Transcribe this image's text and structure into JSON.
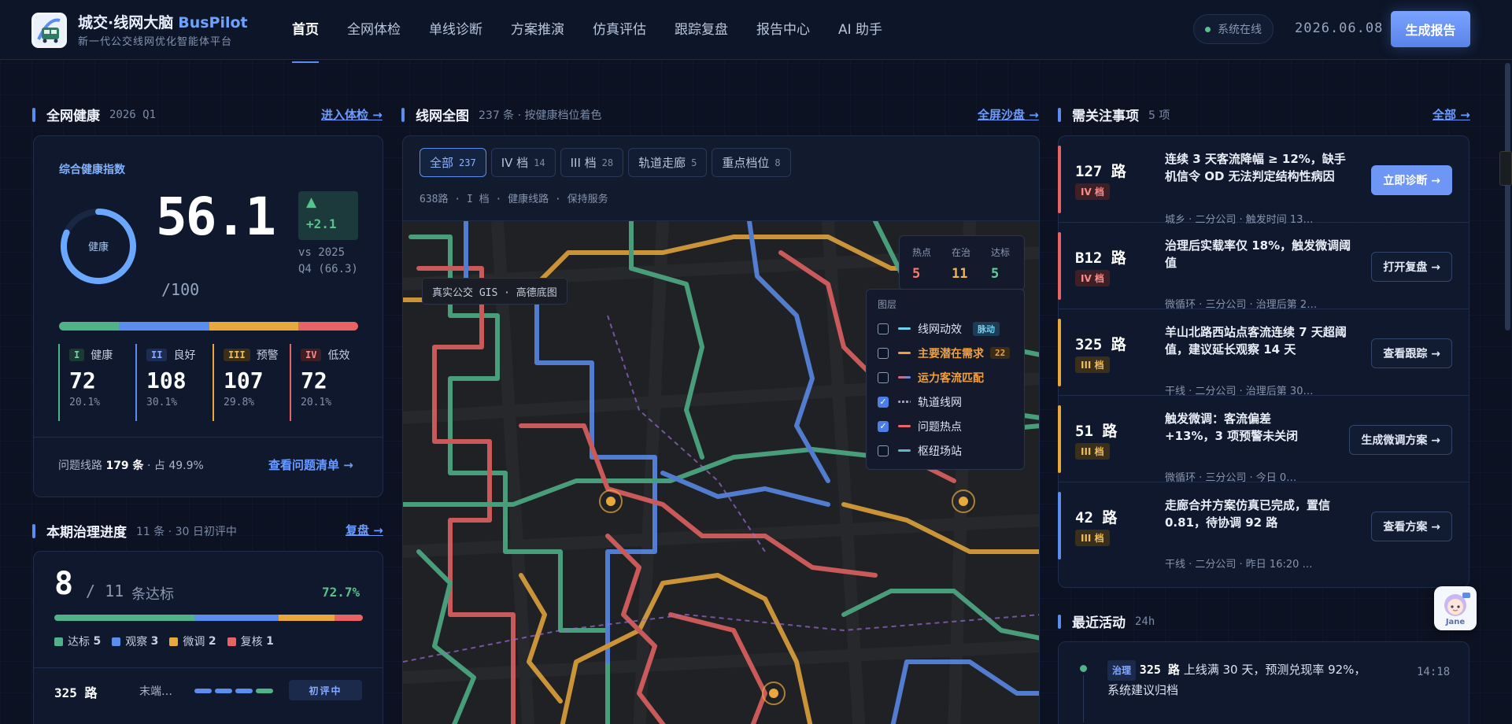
{
  "app": {
    "name_cn": "城交·线网大脑",
    "name_en": "BusPilot",
    "tagline": "新一代公交线网优化智能体平台",
    "status": "系统在线",
    "date": "2026.06.08",
    "generate_report": "生成报告",
    "nav": [
      "首页",
      "全网体检",
      "单线诊断",
      "方案推演",
      "仿真评估",
      "跟踪复盘",
      "报告中心",
      "AI 助手"
    ]
  },
  "health": {
    "title": "全网健康",
    "period": "2026 Q1",
    "link": "进入体检 →",
    "card_label": "综合健康指数",
    "ring_label": "健康",
    "ring_fraction": 0.561,
    "score": "56.1",
    "score_max": "/100",
    "delta_arrow": "▲",
    "delta": "+2.1",
    "compare": "vs 2025 Q4 (66.3)",
    "levels": [
      {
        "code": "I",
        "name": "健康",
        "count": "72",
        "pct": "20.1%",
        "color": "#4fb38a",
        "share": 0.201
      },
      {
        "code": "II",
        "name": "良好",
        "count": "108",
        "pct": "30.1%",
        "color": "#5b8def",
        "share": 0.301
      },
      {
        "code": "III",
        "name": "预警",
        "count": "107",
        "pct": "29.8%",
        "color": "#e8a83c",
        "share": 0.298
      },
      {
        "code": "IV",
        "name": "低效",
        "count": "72",
        "pct": "20.1%",
        "color": "#e86464",
        "share": 0.201
      }
    ],
    "problem_prefix": "问题线路",
    "problem_count": "179 条",
    "problem_share": "· 占 49.9%",
    "problem_link": "查看问题清单 →"
  },
  "progress": {
    "title": "本期治理进度",
    "sub": "11 条 · 30 日初评中",
    "link": "复盘 →",
    "done": "8",
    "total": "/ 11",
    "unit": "条达标",
    "rate": "72.7%",
    "segments": [
      {
        "label": "达标",
        "count": "5",
        "color": "#4fb38a",
        "share": 0.4545
      },
      {
        "label": "观察",
        "count": "3",
        "color": "#5b8def",
        "share": 0.2727
      },
      {
        "label": "微调",
        "count": "2",
        "color": "#e8a83c",
        "share": 0.1818
      },
      {
        "label": "复核",
        "count": "1",
        "color": "#e86464",
        "share": 0.0909
      }
    ],
    "row": {
      "route": "325 路",
      "desc": "末端…",
      "badge": "初评中"
    }
  },
  "map": {
    "title": "线网全图",
    "sub": "237 条 · 按健康档位着色",
    "link": "全屏沙盘 →",
    "tabs": [
      {
        "label": "全部",
        "count": "237"
      },
      {
        "label": "IV 档",
        "count": "14"
      },
      {
        "label": "III 档",
        "count": "28"
      },
      {
        "label": "轨道走廊",
        "count": "5"
      },
      {
        "label": "重点档位",
        "count": "8"
      }
    ],
    "hint": "638路 · I 档 · 健康线路 · 保持服务",
    "overlay_label": "真实公交 GIS · 高德底图",
    "stats": [
      {
        "label": "热点",
        "value": "5",
        "color": "#ff7a6a"
      },
      {
        "label": "在治",
        "value": "11",
        "color": "#f0b44a"
      },
      {
        "label": "达标",
        "value": "5",
        "color": "#5fcf98"
      }
    ],
    "layers_title": "图层",
    "layers": [
      {
        "label": "线网动效",
        "checked": false,
        "color": "#6fd0f0",
        "badge": "脉动"
      },
      {
        "label": "主要潜在需求",
        "checked": false,
        "color": "#f0a040",
        "badge": "22"
      },
      {
        "label": "运力客流匹配",
        "checked": false,
        "color": "#e86464",
        "badge": ""
      },
      {
        "label": "轨道线网",
        "checked": true,
        "color": "#8fa0c0",
        "badge": ""
      },
      {
        "label": "问题热点",
        "checked": true,
        "color": "#e86464",
        "badge": ""
      },
      {
        "label": "枢纽场站",
        "checked": false,
        "color": "#5fb8c8",
        "badge": ""
      }
    ]
  },
  "alerts": {
    "title": "需关注事项",
    "count": "5 项",
    "link": "全部 →",
    "items": [
      {
        "route": "127 路",
        "level": "IV 档",
        "color": "#e86464",
        "text": "连续 3 天客流降幅 ≥ 12%，缺手机信令 OD 无法判定结构性病因",
        "meta": "城乡 · 二分公司 · 触发时间 13…",
        "action": "立即诊断 →",
        "primary": true
      },
      {
        "route": "B12 路",
        "level": "IV 档",
        "color": "#e86464",
        "text": "治理后实载率仅 18%，触发微调阈值",
        "meta": "微循环 · 三分公司 · 治理后第 2…",
        "action": "打开复盘 →",
        "primary": false
      },
      {
        "route": "325 路",
        "level": "III 档",
        "color": "#e8a83c",
        "text": "羊山北路西站点客流连续 7 天超阈值，建议延长观察 14 天",
        "meta": "干线 · 二分公司 · 治理后第 30…",
        "action": "查看跟踪 →",
        "primary": false
      },
      {
        "route": "51 路",
        "level": "III 档",
        "color": "#e8a83c",
        "text": "触发微调：客流偏差 +13%，3 项预警未关闭",
        "meta": "微循环 · 三分公司 · 今日 0…",
        "action": "生成微调方案 →",
        "primary": false
      },
      {
        "route": "42 路",
        "level": "III 档",
        "color": "#5b8def",
        "text": "走廊合并方案仿真已完成，置信 0.81，待协调 92 路",
        "meta": "干线 · 二分公司 · 昨日 16:20 …",
        "action": "查看方案 →",
        "primary": false
      }
    ]
  },
  "activity": {
    "title": "最近活动",
    "window": "24h",
    "item": {
      "tag": "治理",
      "route": "325 路",
      "text": "上线满 30 天，预测兑现率 92%，系统建议归档",
      "time": "14:18"
    }
  },
  "assistant": {
    "name": "Jane"
  },
  "colors": {
    "accent": "#5b8def",
    "green": "#4fb38a",
    "amber": "#e8a83c",
    "red": "#e86464"
  }
}
